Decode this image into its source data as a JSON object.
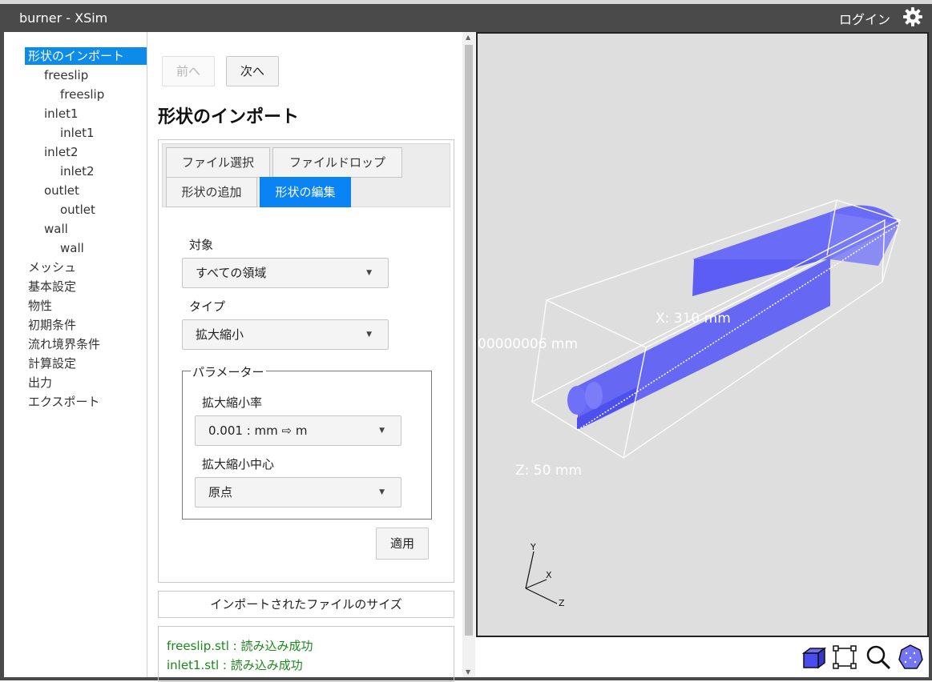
{
  "app": {
    "title": "burner - XSim",
    "login_label": "ログイン",
    "settings_icon": "gear-icon",
    "accent_color": "#0a84f4"
  },
  "sidebar": {
    "items": [
      {
        "label": "形状のインポート",
        "active": true
      },
      {
        "label": "freeslip"
      },
      {
        "label": "freeslip"
      },
      {
        "label": "inlet1"
      },
      {
        "label": "inlet1"
      },
      {
        "label": "inlet2"
      },
      {
        "label": "inlet2"
      },
      {
        "label": "outlet"
      },
      {
        "label": "outlet"
      },
      {
        "label": "wall"
      },
      {
        "label": "wall"
      },
      {
        "label": "メッシュ"
      },
      {
        "label": "基本設定"
      },
      {
        "label": "物性"
      },
      {
        "label": "初期条件"
      },
      {
        "label": "流れ境界条件"
      },
      {
        "label": "計算設定"
      },
      {
        "label": "出力"
      },
      {
        "label": "エクスポート"
      }
    ]
  },
  "nav": {
    "prev_label": "前へ",
    "next_label": "次へ"
  },
  "page_title": "形状のインポート",
  "tabs": [
    {
      "label": "ファイル選択"
    },
    {
      "label": "ファイルドロップ"
    },
    {
      "label": "形状の追加"
    },
    {
      "label": "形状の編集",
      "active": true
    }
  ],
  "form": {
    "target_label": "対象",
    "target_value": "すべての領域",
    "type_label": "タイプ",
    "type_value": "拡大縮小",
    "params_legend": "パラメーター",
    "scale_label": "拡大縮小率",
    "scale_value": "0.001 : mm ⇨ m",
    "center_label": "拡大縮小中心",
    "center_value": "原点",
    "apply_label": "適用"
  },
  "imported_size_label": "インポートされたファイルのサイズ",
  "log": [
    "freeslip.stl : 読み込み成功",
    "inlet1.stl : 読み込み成功"
  ],
  "viewer": {
    "background": "#dedede",
    "model_color": "#5a5cf5",
    "dim_x": "X: 310 mm",
    "dim_y": "00000006 mm",
    "dim_z": "Z: 50 mm",
    "axes": {
      "x": "X",
      "y": "Y",
      "z": "Z"
    }
  },
  "toolbar": {
    "icons": [
      "cube-view-icon",
      "fit-bounds-icon",
      "zoom-icon",
      "wireframe-sphere-icon"
    ]
  }
}
